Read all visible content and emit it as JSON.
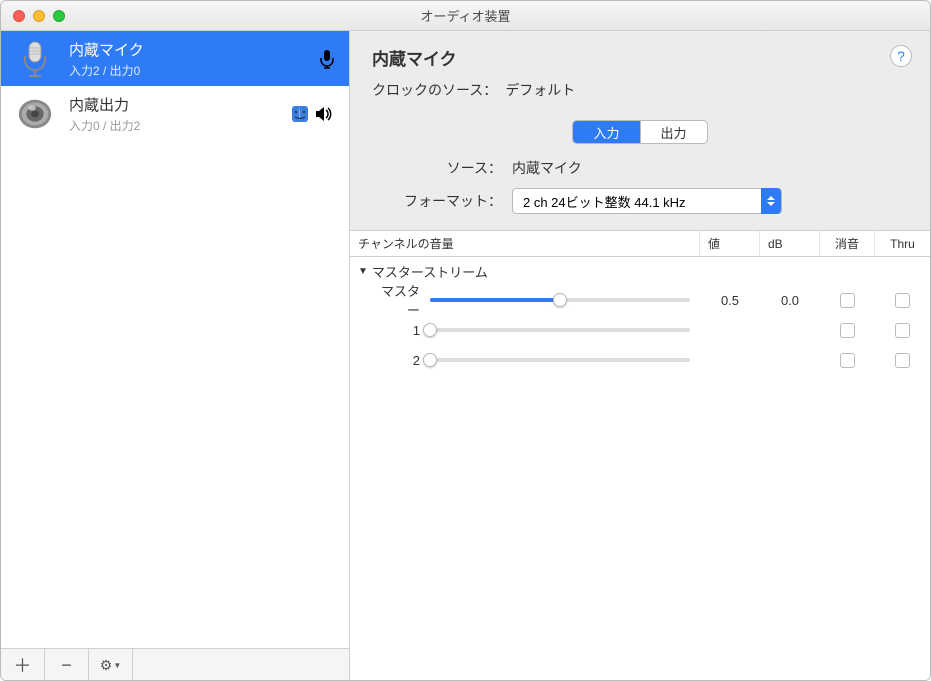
{
  "window": {
    "title": "オーディオ装置"
  },
  "sidebar": {
    "devices": [
      {
        "name": "内蔵マイク",
        "subtitle": "入力2 / 出力0",
        "selected": true,
        "icon": "mic"
      },
      {
        "name": "内蔵出力",
        "subtitle": "入力0 / 出力2",
        "selected": false,
        "icon": "speaker"
      }
    ],
    "footer": {
      "add": "＋",
      "remove": "−",
      "gear": "⚙"
    }
  },
  "detail": {
    "title": "内蔵マイク",
    "clock_label": "クロックのソース：",
    "clock_value": "デフォルト",
    "help": "?",
    "tabs": {
      "input": "入力",
      "output": "出力",
      "active": "input"
    },
    "source_label": "ソース：",
    "source_value": "内蔵マイク",
    "format_label": "フォーマット：",
    "format_value": "2 ch 24ビット整数 44.1 kHz",
    "columns": {
      "volume": "チャンネルの音量",
      "value": "値",
      "db": "dB",
      "mute": "消音",
      "thru": "Thru"
    },
    "stream_name": "マスターストリーム",
    "channels": [
      {
        "label": "マスター",
        "fill": 50,
        "value": "0.5",
        "db": "0.0"
      },
      {
        "label": "1",
        "fill": 0,
        "value": "",
        "db": ""
      },
      {
        "label": "2",
        "fill": 0,
        "value": "",
        "db": ""
      }
    ]
  }
}
